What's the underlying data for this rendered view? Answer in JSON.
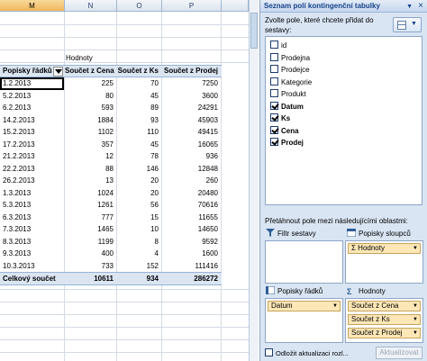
{
  "sheet": {
    "columns": [
      {
        "letter": "M",
        "selected": true
      },
      {
        "letter": "N",
        "selected": false
      },
      {
        "letter": "O",
        "selected": false
      },
      {
        "letter": "P",
        "selected": false
      }
    ],
    "values_caption": "Hodnoty",
    "row_labels_header": "Popisky řádků",
    "value_headers": [
      "Součet z Cena",
      "Součet z Ks",
      "Součet z Prodej"
    ],
    "rows": [
      {
        "label": "1.2.2013",
        "cena": "225",
        "ks": "70",
        "prodej": "7250"
      },
      {
        "label": "5.2.2013",
        "cena": "80",
        "ks": "45",
        "prodej": "3600"
      },
      {
        "label": "6.2.2013",
        "cena": "593",
        "ks": "89",
        "prodej": "24291"
      },
      {
        "label": "14.2.2013",
        "cena": "1884",
        "ks": "93",
        "prodej": "45903"
      },
      {
        "label": "15.2.2013",
        "cena": "1102",
        "ks": "110",
        "prodej": "49415"
      },
      {
        "label": "17.2.2013",
        "cena": "357",
        "ks": "45",
        "prodej": "16065"
      },
      {
        "label": "21.2.2013",
        "cena": "12",
        "ks": "78",
        "prodej": "936"
      },
      {
        "label": "22.2.2013",
        "cena": "88",
        "ks": "146",
        "prodej": "12848"
      },
      {
        "label": "26.2.2013",
        "cena": "13",
        "ks": "20",
        "prodej": "260"
      },
      {
        "label": "1.3.2013",
        "cena": "1024",
        "ks": "20",
        "prodej": "20480"
      },
      {
        "label": "5.3.2013",
        "cena": "1261",
        "ks": "56",
        "prodej": "70616"
      },
      {
        "label": "6.3.2013",
        "cena": "777",
        "ks": "15",
        "prodej": "11655"
      },
      {
        "label": "7.3.2013",
        "cena": "1465",
        "ks": "10",
        "prodej": "14650"
      },
      {
        "label": "8.3.2013",
        "cena": "1199",
        "ks": "8",
        "prodej": "9592"
      },
      {
        "label": "9.3.2013",
        "cena": "400",
        "ks": "4",
        "prodej": "1600"
      },
      {
        "label": "10.3.2013",
        "cena": "733",
        "ks": "152",
        "prodej": "111416"
      }
    ],
    "total": {
      "label": "Celkový součet",
      "cena": "10611",
      "ks": "934",
      "prodej": "286272"
    }
  },
  "pane": {
    "title": "Seznam polí kontingenční tabulky",
    "prompt": "Zvolte pole, které chcete přidat do sestavy:",
    "fields": [
      {
        "label": "id",
        "checked": false
      },
      {
        "label": "Prodejna",
        "checked": false
      },
      {
        "label": "Prodejce",
        "checked": false
      },
      {
        "label": "Kategorie",
        "checked": false
      },
      {
        "label": "Produkt",
        "checked": false
      },
      {
        "label": "Datum",
        "checked": true
      },
      {
        "label": "Ks",
        "checked": true
      },
      {
        "label": "Cena",
        "checked": true
      },
      {
        "label": "Prodej",
        "checked": true
      }
    ],
    "drag_label": "Přetáhnout pole mezi následujícími oblastmi:",
    "areas": {
      "filter": {
        "title": "Filtr sestavy"
      },
      "columns": {
        "title": "Popisky sloupců",
        "chips": [
          "Hodnoty"
        ]
      },
      "rows": {
        "title": "Popisky řádků",
        "chips": [
          "Datum"
        ]
      },
      "values": {
        "title": "Hodnoty",
        "chips": [
          "Součet z Cena",
          "Součet z Ks",
          "Součet z Prodej"
        ]
      }
    },
    "defer_label": "Odložit aktualizaci rozl...",
    "update_label": "Aktualizovat"
  }
}
